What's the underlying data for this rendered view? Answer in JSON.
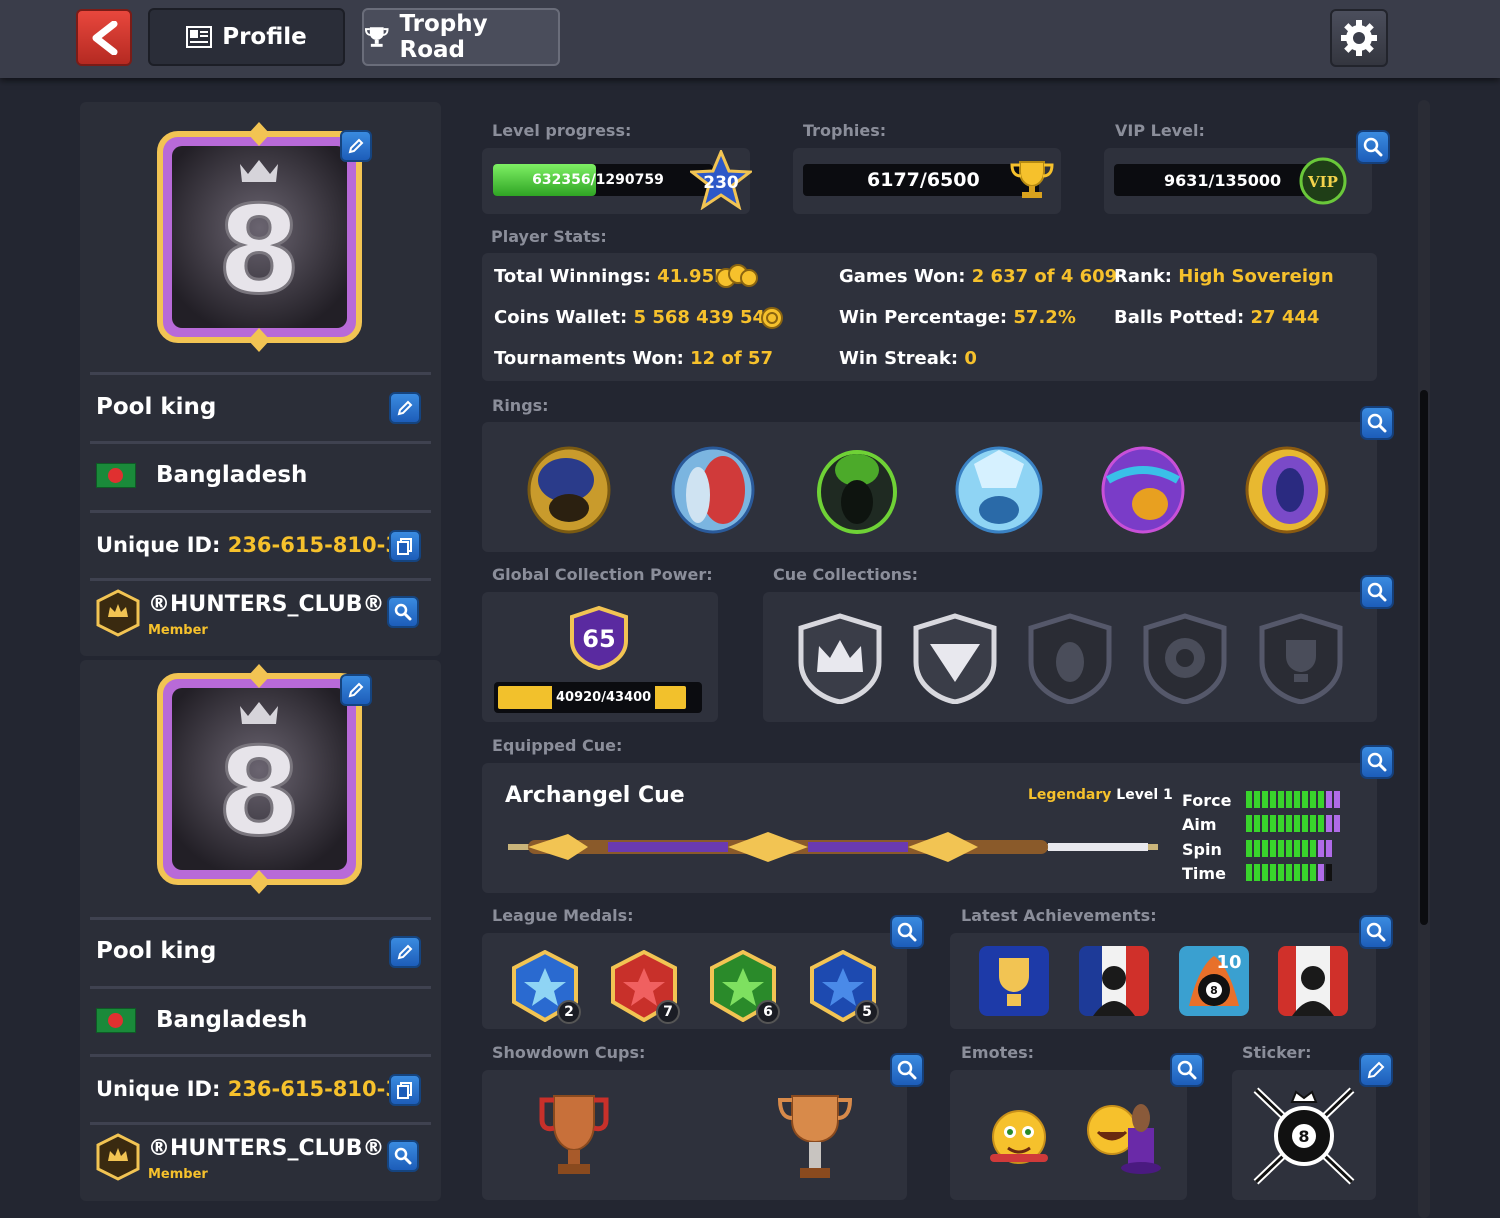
{
  "header": {
    "back_icon": "back-arrow-icon",
    "profile_tab": "Profile",
    "trophy_tab": "Trophy Road",
    "settings_icon": "gear-icon"
  },
  "profiles": [
    {
      "name": "Pool king",
      "country": "Bangladesh",
      "unique_id_label": "Unique ID:",
      "unique_id": "236-615-810-3",
      "club": "®HUNTERS_CLUB®",
      "club_role": "Member",
      "avatar_number": "8"
    },
    {
      "name": "Pool king",
      "country": "Bangladesh",
      "unique_id_label": "Unique ID:",
      "unique_id": "236-615-810-3",
      "club": "®HUNTERS_CLUB®",
      "club_role": "Member",
      "avatar_number": "8"
    }
  ],
  "level": {
    "label": "Level progress:",
    "value": "632356/1290759",
    "level": "230",
    "progress": 0.49
  },
  "trophies": {
    "label": "Trophies:",
    "value": "6177/6500"
  },
  "vip": {
    "label": "VIP Level:",
    "value": "9631/135000",
    "badge": "VIP"
  },
  "player_stats": {
    "label": "Player Stats:",
    "total_winnings_label": "Total Winnings:",
    "total_winnings": "41.95B",
    "coins_wallet_label": "Coins Wallet:",
    "coins_wallet": "5 568 439 547",
    "tournaments_won_label": "Tournaments Won:",
    "tournaments_won": "12 of 57",
    "games_won_label": "Games Won:",
    "games_won": "2 637 of 4 609",
    "win_percentage_label": "Win Percentage:",
    "win_percentage": "57.2%",
    "win_streak_label": "Win Streak:",
    "win_streak": "0",
    "rank_label": "Rank:",
    "rank": "High Sovereign",
    "balls_potted_label": "Balls Potted:",
    "balls_potted": "27 444"
  },
  "rings": {
    "label": "Rings:"
  },
  "collection_power": {
    "label": "Global Collection Power:",
    "level": "65",
    "value": "40920/43400",
    "progress": 0.94
  },
  "cue_collections": {
    "label": "Cue Collections:"
  },
  "equipped_cue": {
    "label": "Equipped Cue:",
    "name": "Archangel Cue",
    "rarity": "Legendary",
    "level": "Level 1",
    "stats": [
      {
        "name": "Force",
        "green": 10,
        "purple": 2,
        "empty": 0
      },
      {
        "name": "Aim",
        "green": 10,
        "purple": 2,
        "empty": 0
      },
      {
        "name": "Spin",
        "green": 9,
        "purple": 2,
        "empty": 0
      },
      {
        "name": "Time",
        "green": 9,
        "purple": 1,
        "empty": 1
      }
    ]
  },
  "league_medals": {
    "label": "League Medals:",
    "counts": [
      "2",
      "7",
      "6",
      "5"
    ]
  },
  "latest_achievements": {
    "label": "Latest Achievements:",
    "badge_number": "10",
    "ball_number": "8"
  },
  "showdown_cups": {
    "label": "Showdown Cups:"
  },
  "emotes": {
    "label": "Emotes:"
  },
  "sticker": {
    "label": "Sticker:",
    "ball_number": "8"
  },
  "colors": {
    "gold": "#f6c12c",
    "panel": "#2e313c",
    "background": "#232631",
    "accent_blue": "#2a74d0"
  }
}
